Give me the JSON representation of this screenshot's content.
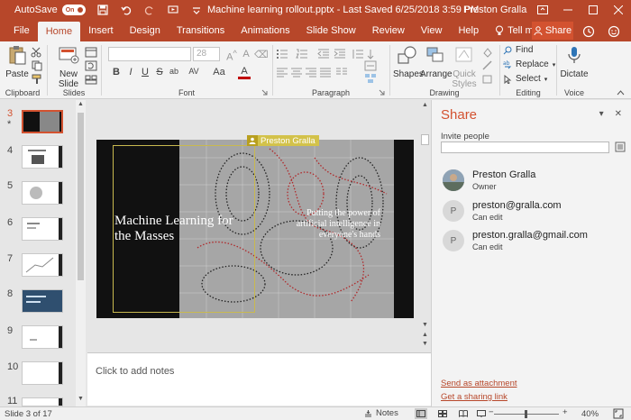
{
  "titlebar": {
    "autosave_label": "AutoSave",
    "autosave_state": "On",
    "title": "Machine learning rollout.pptx  -  Last Saved 6/25/2018 3:59 PM",
    "user": "Preston Gralla"
  },
  "tabs": [
    {
      "label": "File"
    },
    {
      "label": "Home"
    },
    {
      "label": "Insert"
    },
    {
      "label": "Design"
    },
    {
      "label": "Transitions"
    },
    {
      "label": "Animations"
    },
    {
      "label": "Slide Show"
    },
    {
      "label": "Review"
    },
    {
      "label": "View"
    },
    {
      "label": "Help"
    }
  ],
  "tell_me": "Tell me",
  "share_button": "Share",
  "ribbon": {
    "clipboard": {
      "label": "Clipboard",
      "paste": "Paste"
    },
    "slides": {
      "label": "Slides",
      "new_slide_line1": "New",
      "new_slide_line2": "Slide"
    },
    "font": {
      "label": "Font",
      "font_size": "28",
      "bold": "B",
      "italic": "I",
      "underline": "U",
      "strike": "S",
      "shadow": "ab",
      "spacing": "AV",
      "case": "Aa",
      "color": "A"
    },
    "paragraph": {
      "label": "Paragraph"
    },
    "drawing": {
      "label": "Drawing",
      "shapes": "Shapes",
      "arrange": "Arrange",
      "quick_styles_1": "Quick",
      "quick_styles_2": "Styles"
    },
    "editing": {
      "label": "Editing",
      "find": "Find",
      "replace": "Replace",
      "select": "Select"
    },
    "voice": {
      "label": "Voice",
      "dictate": "Dictate"
    }
  },
  "thumbnails": [
    {
      "number": "3",
      "mark": "*"
    },
    {
      "number": "4"
    },
    {
      "number": "5"
    },
    {
      "number": "6"
    },
    {
      "number": "7"
    },
    {
      "number": "8"
    },
    {
      "number": "9"
    },
    {
      "number": "10"
    },
    {
      "number": "11"
    }
  ],
  "slide": {
    "title": "Machine Learning for the Masses",
    "subtitle": "Putting the power of artificial intelligence in everyone's hands",
    "presence_user": "Preston Gralla"
  },
  "notes": {
    "placeholder": "Click to add notes"
  },
  "share_pane": {
    "title": "Share",
    "invite_label": "Invite people",
    "people": [
      {
        "initial": "",
        "name": "Preston Gralla",
        "role": "Owner"
      },
      {
        "initial": "P",
        "name": "preston@gralla.com",
        "role": "Can edit"
      },
      {
        "initial": "P",
        "name": "preston.gralla@gmail.com",
        "role": "Can edit"
      }
    ],
    "send_attachment": "Send as attachment",
    "sharing_link": "Get a sharing link"
  },
  "status": {
    "slide_count": "Slide 3 of 17",
    "notes": "Notes",
    "zoom": "40%",
    "zoom_fraction": 0.4
  },
  "colors": {
    "accent": "#b7472a",
    "accent_light": "#d35230",
    "presence": "#d3c24a"
  }
}
